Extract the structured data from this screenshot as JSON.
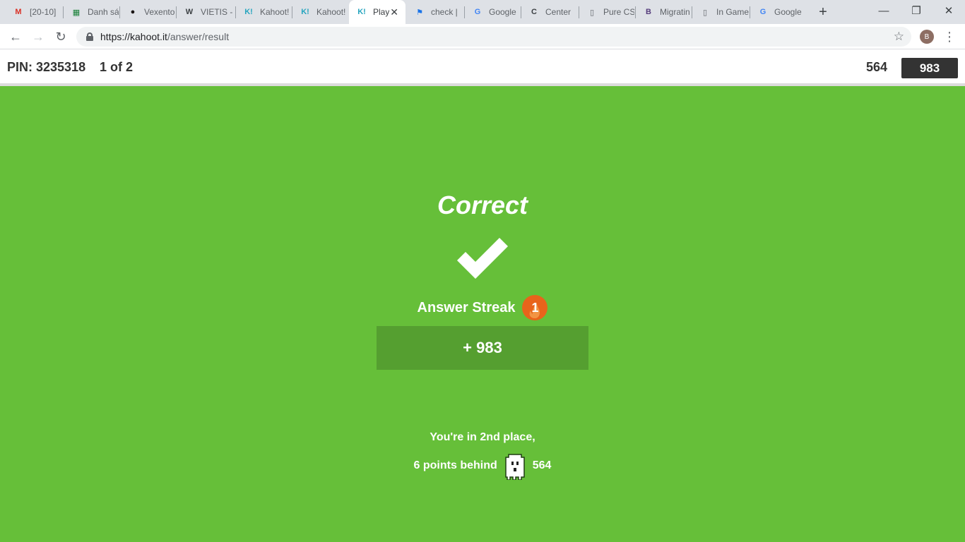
{
  "browser": {
    "tabs": [
      {
        "title": "[20-10]",
        "icon": "gmail-icon",
        "color": "#d93025",
        "glyph": "M"
      },
      {
        "title": "Danh sá",
        "icon": "sheets-icon",
        "color": "#188038",
        "glyph": "▦"
      },
      {
        "title": "Vexento",
        "icon": "spotify-icon",
        "color": "#191414",
        "glyph": "●"
      },
      {
        "title": "VIETIS -",
        "icon": "wordpress-icon",
        "color": "#3c4043",
        "glyph": "W"
      },
      {
        "title": "Kahoot!",
        "icon": "kahoot-icon",
        "color": "#26a5bf",
        "glyph": "K!"
      },
      {
        "title": "Kahoot!",
        "icon": "kahoot-icon",
        "color": "#26a5bf",
        "glyph": "K!"
      },
      {
        "title": "Play",
        "icon": "kahoot-icon",
        "color": "#26a5bf",
        "glyph": "K!",
        "active": true
      },
      {
        "title": "check |",
        "icon": "flag-icon",
        "color": "#1a73e8",
        "glyph": "⚑"
      },
      {
        "title": "Google",
        "icon": "google-translate-icon",
        "color": "#4285f4",
        "glyph": "G"
      },
      {
        "title": "Center",
        "icon": "c-icon",
        "color": "#3c4043",
        "glyph": "C"
      },
      {
        "title": "Pure CS",
        "icon": "document-icon",
        "color": "#5f6368",
        "glyph": "▯"
      },
      {
        "title": "Migratin",
        "icon": "bootstrap-icon",
        "color": "#563d7c",
        "glyph": "B"
      },
      {
        "title": "In Game",
        "icon": "document-icon",
        "color": "#5f6368",
        "glyph": "▯"
      },
      {
        "title": "Google",
        "icon": "google-translate-icon",
        "color": "#4285f4",
        "glyph": "G"
      }
    ],
    "url_host": "https://kahoot.it",
    "url_path": "/answer/result",
    "profile_initial": "B"
  },
  "header": {
    "pin": "PIN: 3235318",
    "question_count": "1 of 2",
    "rival_score": "564",
    "my_score": "983"
  },
  "result": {
    "title": "Correct",
    "streak_label": "Answer Streak",
    "streak_count": "1",
    "points": "+ 983",
    "place_prefix": "You're in ",
    "place_value": "2nd place",
    "place_suffix": ",",
    "behind_text": "6 points behind",
    "behind_score": "564"
  },
  "colors": {
    "background": "#66bf39",
    "points_box": "#559f30",
    "streak_badge": "#e8641b"
  }
}
